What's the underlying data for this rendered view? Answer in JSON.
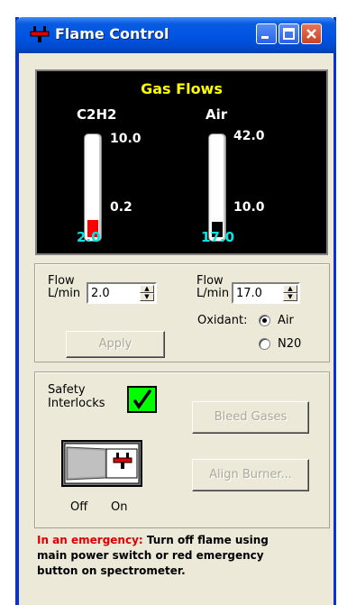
{
  "window": {
    "title": "Flame Control"
  },
  "display": {
    "title": "Gas Flows",
    "c2h2": {
      "name": "C2H2",
      "max": "10.0",
      "min": "0.2",
      "reading": "2.0",
      "level_fraction": 0.18,
      "fill_color": "#ff0000"
    },
    "air": {
      "name": "Air",
      "max": "42.0",
      "min": "10.0",
      "reading": "17.0",
      "level_fraction": 0.16,
      "fill_color": "#000000"
    }
  },
  "flow": {
    "left_label_1": "Flow",
    "left_label_2": "L/min",
    "left_value": "2.0",
    "right_label_1": "Flow",
    "right_label_2": "L/min",
    "right_value": "17.0",
    "apply_label": "Apply",
    "oxidant_label": "Oxidant:",
    "oxidant_options": [
      "Air",
      "N20"
    ],
    "oxidant_selected": "Air"
  },
  "safety": {
    "label_1": "Safety",
    "label_2": "Interlocks",
    "interlock_ok": true,
    "bleed_label": "Bleed Gases",
    "align_label": "Align Burner...",
    "off_label": "Off",
    "on_label": "On"
  },
  "footer": {
    "emergency_prefix": "In an emergency:",
    "line1_rest": " Turn off flame using",
    "line2": "main power switch or red emergency",
    "line3": "button on spectrometer."
  },
  "colors": {
    "titlebar": "#0054e3",
    "window_bg": "#ece9d8",
    "gas_title": "#ffff00",
    "reading": "#00e5e5",
    "interlock": "#00ff00",
    "emergency": "#e00000"
  }
}
